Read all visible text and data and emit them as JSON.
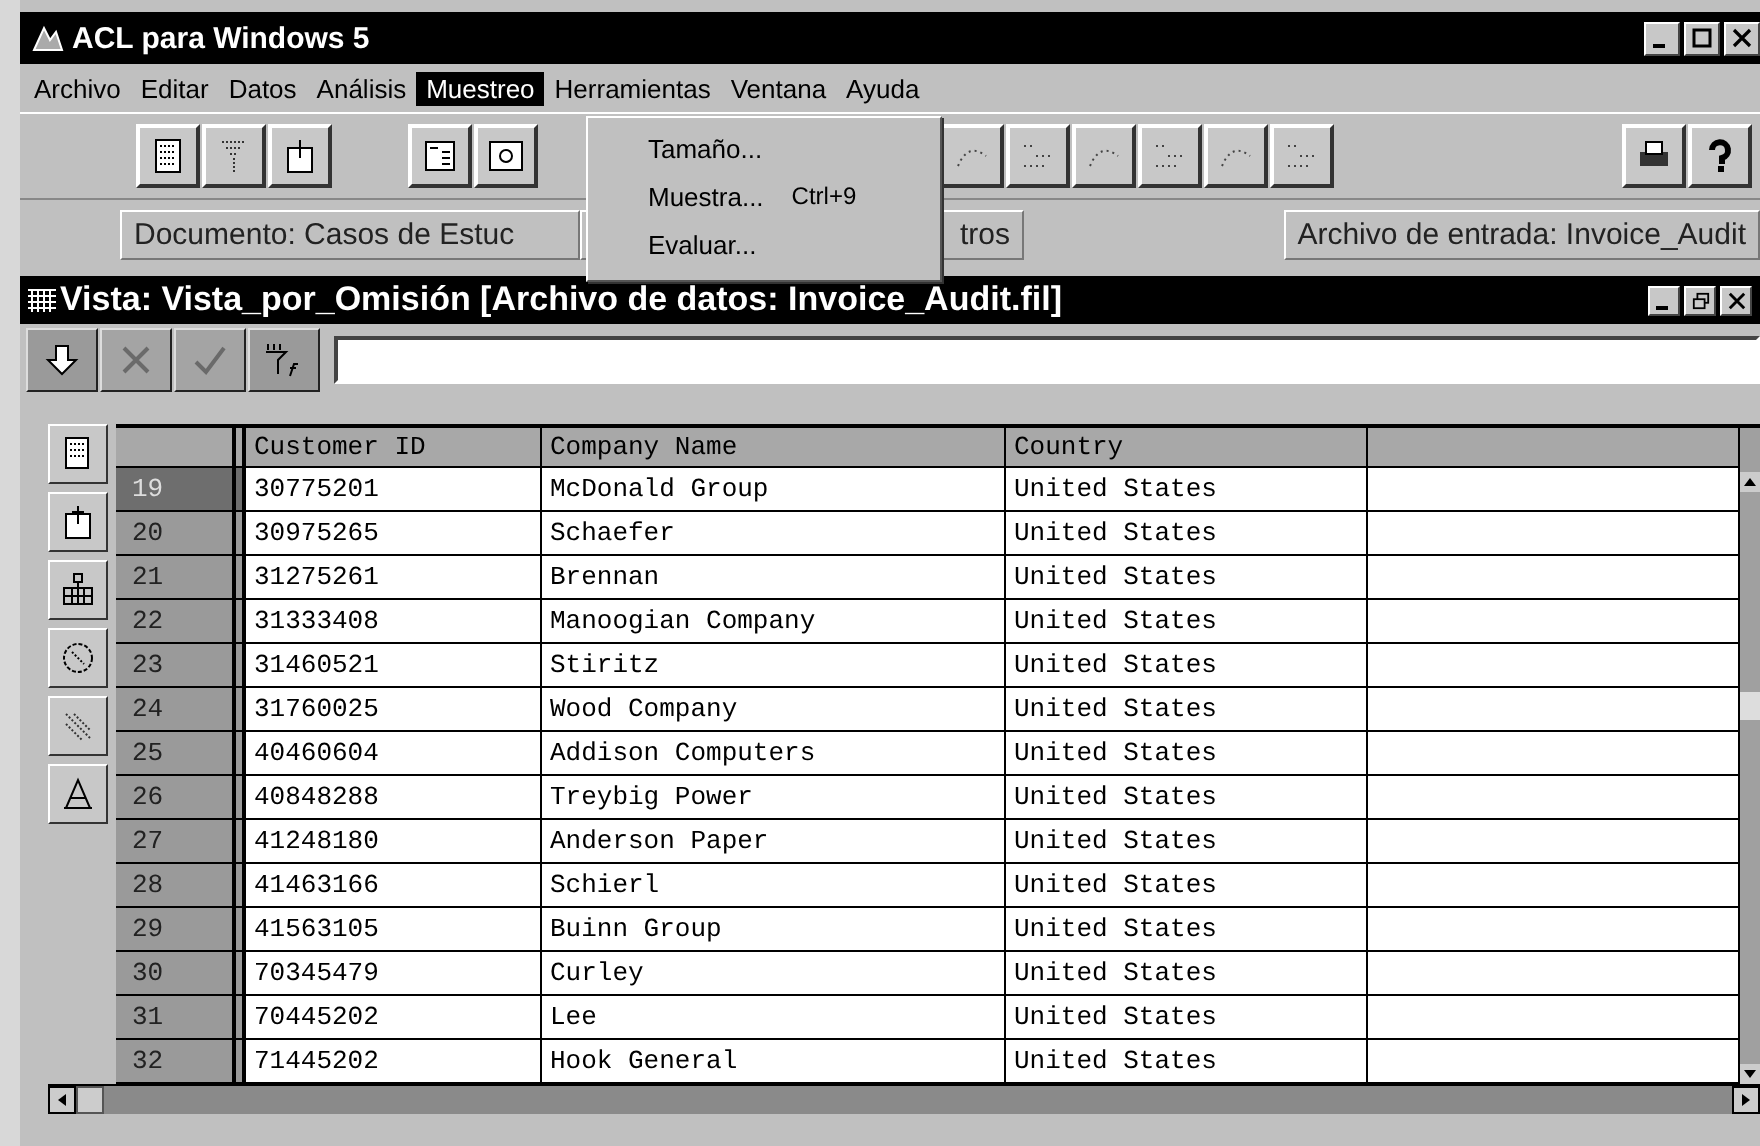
{
  "window": {
    "title": "ACL para Windows 5"
  },
  "menu": [
    {
      "label": "Archivo",
      "selected": false
    },
    {
      "label": "Editar",
      "selected": false
    },
    {
      "label": "Datos",
      "selected": false
    },
    {
      "label": "Análisis",
      "selected": false
    },
    {
      "label": "Muestreo",
      "selected": true
    },
    {
      "label": "Herramientas",
      "selected": false
    },
    {
      "label": "Ventana",
      "selected": false
    },
    {
      "label": "Ayuda",
      "selected": false
    }
  ],
  "dropdown": {
    "items": [
      {
        "label": "Tamaño..."
      },
      {
        "label": "Muestra...",
        "shortcut": "Ctrl+9"
      },
      {
        "label": "Evaluar..."
      }
    ]
  },
  "status_fields": [
    "Documento: Casos de Estuc",
    "tros",
    "Archivo de entrada: Invoice_Audit"
  ],
  "view": {
    "title": "Vista: Vista_por_Omisión [Archivo de datos: Invoice_Audit.fil]",
    "edit_buttons": [
      {
        "kind": "down",
        "disabled": false
      },
      {
        "kind": "cancel",
        "disabled": true
      },
      {
        "kind": "accept",
        "disabled": true
      },
      {
        "kind": "filter",
        "disabled": false
      }
    ],
    "table": {
      "columns": [
        "Customer ID",
        "Company Name",
        "Country"
      ],
      "rows": [
        {
          "number": "19",
          "selected": true,
          "cells": [
            "30775201",
            "McDonald Group",
            "United States"
          ]
        },
        {
          "number": "20",
          "selected": false,
          "cells": [
            "30975265",
            "Schaefer",
            "United States"
          ]
        },
        {
          "number": "21",
          "selected": false,
          "cells": [
            "31275261",
            "Brennan",
            "United States"
          ]
        },
        {
          "number": "22",
          "selected": false,
          "cells": [
            "31333408",
            "Manoogian Company",
            "United States"
          ]
        },
        {
          "number": "23",
          "selected": false,
          "cells": [
            "31460521",
            "Stiritz",
            "United States"
          ]
        },
        {
          "number": "24",
          "selected": false,
          "cells": [
            "31760025",
            "Wood Company",
            "United States"
          ]
        },
        {
          "number": "25",
          "selected": false,
          "cells": [
            "40460604",
            "Addison Computers",
            "United States"
          ]
        },
        {
          "number": "26",
          "selected": false,
          "cells": [
            "40848288",
            "Treybig Power",
            "United States"
          ]
        },
        {
          "number": "27",
          "selected": false,
          "cells": [
            "41248180",
            "Anderson Paper",
            "United States"
          ]
        },
        {
          "number": "28",
          "selected": false,
          "cells": [
            "41463166",
            "Schierl",
            "United States"
          ]
        },
        {
          "number": "29",
          "selected": false,
          "cells": [
            "41563105",
            "Buinn Group",
            "United States"
          ]
        },
        {
          "number": "30",
          "selected": false,
          "cells": [
            "70345479",
            "Curley",
            "United States"
          ]
        },
        {
          "number": "31",
          "selected": false,
          "cells": [
            "70445202",
            "Lee",
            "United States"
          ]
        },
        {
          "number": "32",
          "selected": false,
          "cells": [
            "71445202",
            "Hook General",
            "United States"
          ]
        }
      ]
    }
  }
}
